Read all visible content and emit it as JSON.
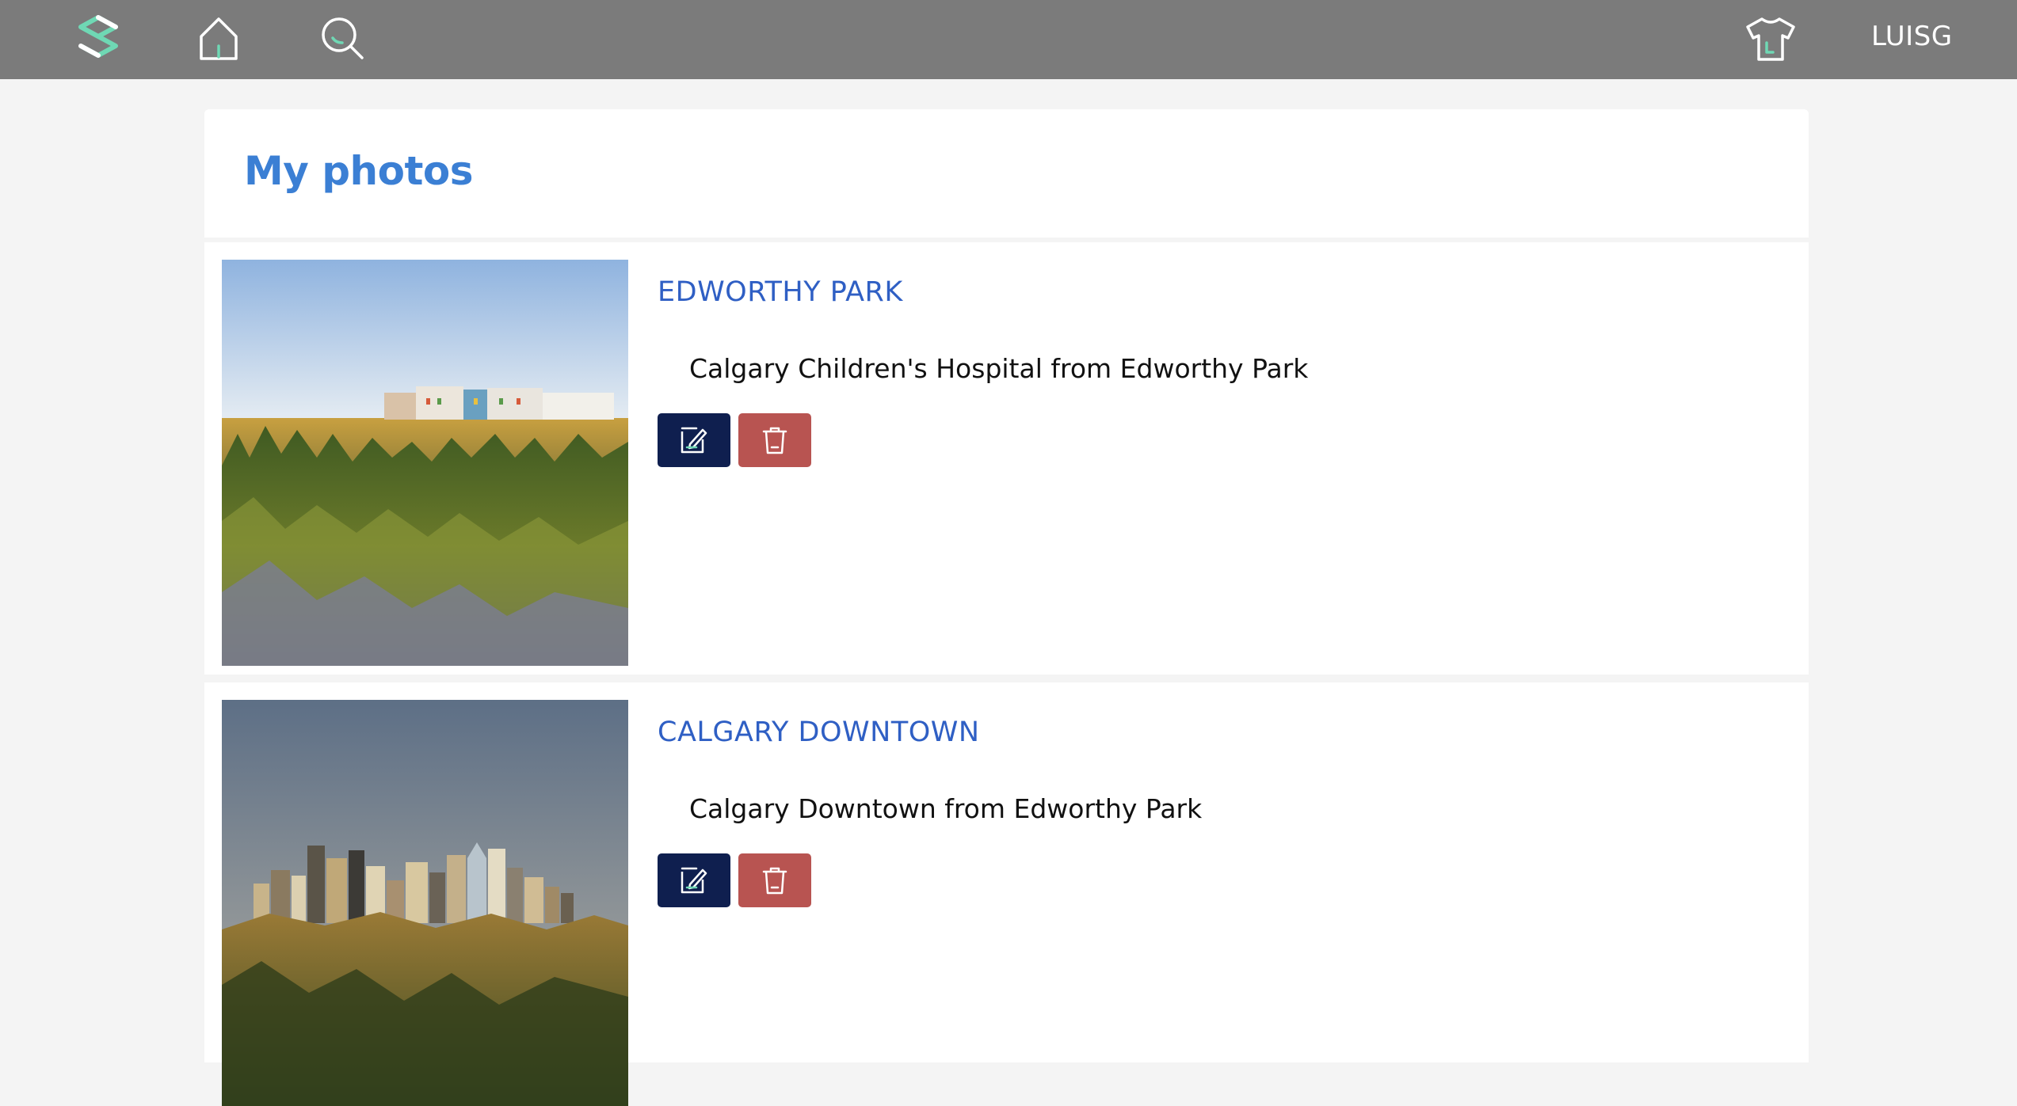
{
  "header": {
    "logo_icon": "stylized-s-logo-icon",
    "home_icon": "home-icon",
    "search_icon": "search-icon",
    "shirt_icon": "t-shirt-icon",
    "username": "LUISG",
    "accent_color": "#6fd8b4",
    "bar_color": "#7b7b7b"
  },
  "page": {
    "title": "My photos",
    "title_color": "#3b7fd4"
  },
  "photos": [
    {
      "title": "EDWORTHY PARK",
      "description": "Calgary Children's Hospital from Edworthy Park",
      "edit_icon": "edit-icon",
      "delete_icon": "trash-icon"
    },
    {
      "title": "CALGARY DOWNTOWN",
      "description": "Calgary Downtown from Edworthy Park",
      "edit_icon": "edit-icon",
      "delete_icon": "trash-icon"
    }
  ],
  "colors": {
    "edit_button": "#0f1f4f",
    "delete_button": "#b85451",
    "photo_title": "#2f5fc4"
  }
}
